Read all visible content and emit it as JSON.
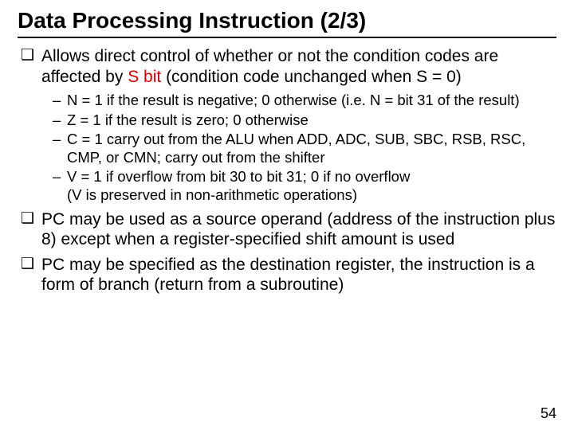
{
  "title": "Data Processing Instruction (2/3)",
  "bullets": {
    "b1_pre": "Allows direct control of whether or not the condition codes are affected by ",
    "b1_sbit": "S bit",
    "b1_post": " (condition code unchanged when S = 0)",
    "sub": {
      "n": "N = 1 if the result is negative; 0 otherwise (i.e. N = bit 31 of the result)",
      "z": "Z = 1 if the result is zero; 0 otherwise",
      "c": "C = 1 carry out from the ALU when ADD, ADC, SUB, SBC, RSB, RSC, CMP, or CMN; carry out from the shifter",
      "v": "V = 1 if overflow from bit 30 to bit 31; 0 if no overflow",
      "v_note": "(V is preserved in non-arithmetic operations)"
    },
    "b2": "PC may be used as a source operand (address of the instruction plus 8) except when a register-specified shift amount is used",
    "b3": "PC may be specified as the destination register, the instruction is a form of branch (return from a subroutine)"
  },
  "page_number": "54"
}
